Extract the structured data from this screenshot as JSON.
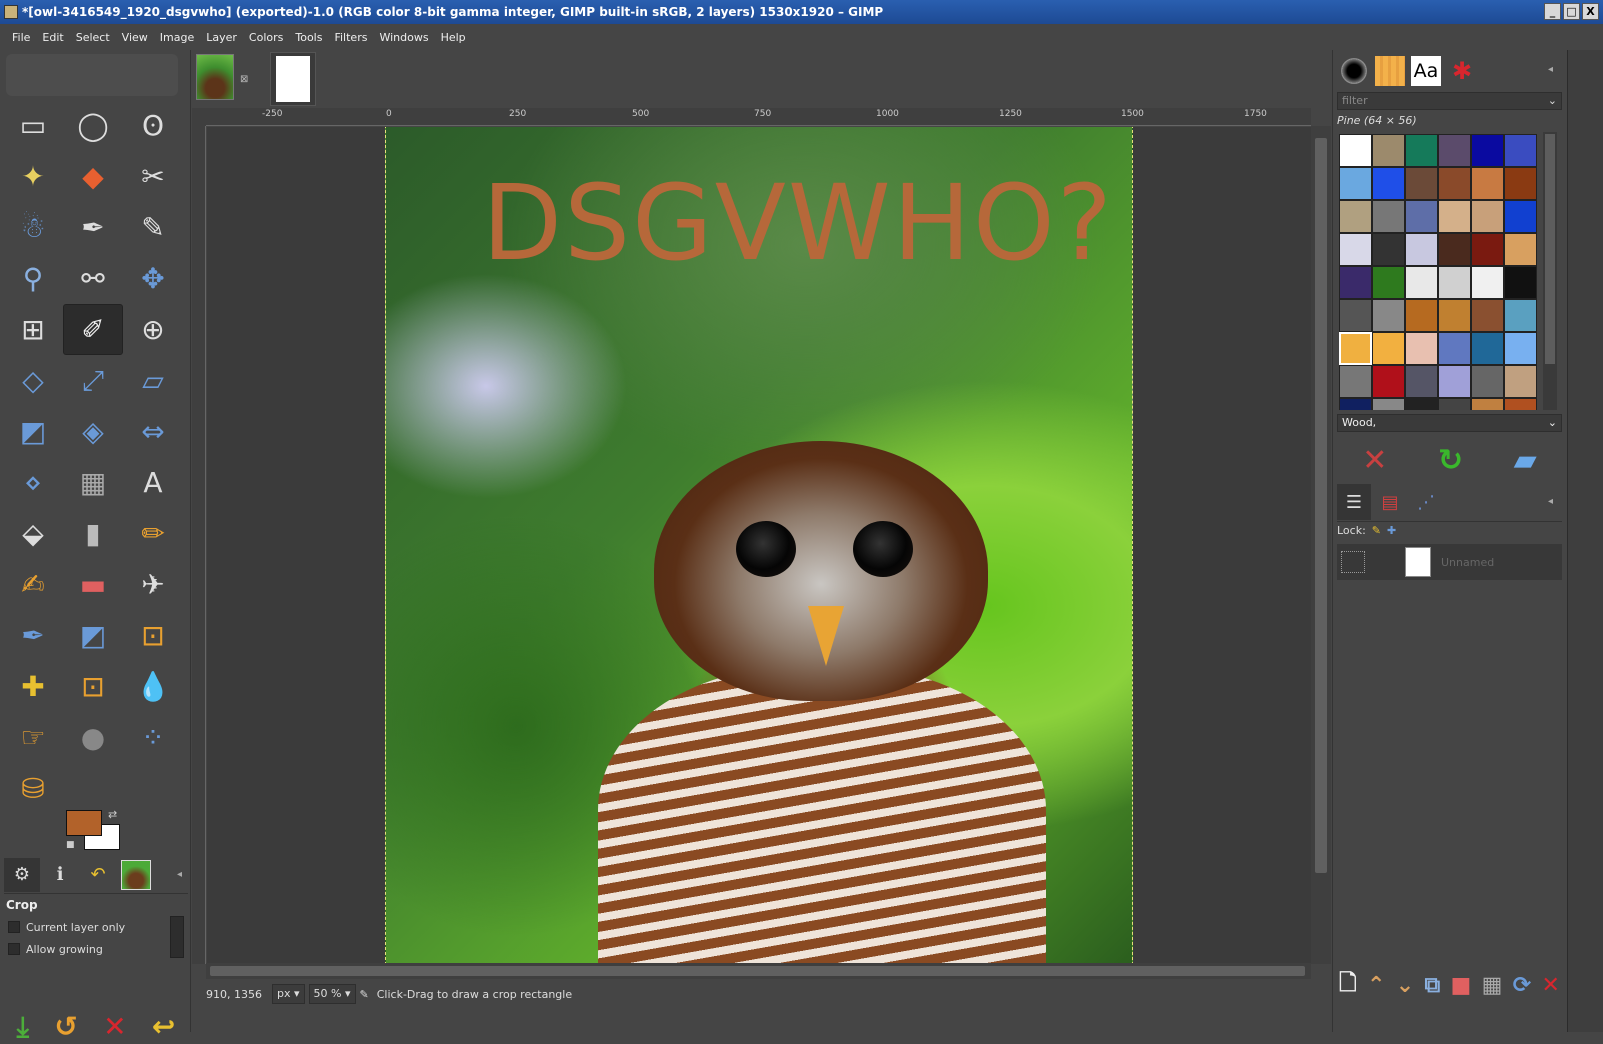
{
  "window": {
    "title": "*[owl-3416549_1920_dsgvwho] (exported)-1.0 (RGB color 8-bit gamma integer, GIMP built-in sRGB, 2 layers) 1530x1920 – GIMP",
    "buttons": [
      "_",
      "□",
      "X"
    ]
  },
  "menubar": [
    "File",
    "Edit",
    "Select",
    "View",
    "Image",
    "Layer",
    "Colors",
    "Tools",
    "Filters",
    "Windows",
    "Help"
  ],
  "toolbox": {
    "tools": [
      "rect-select-tool-icon",
      "ellipse-select-tool-icon",
      "free-select-tool-icon",
      "fuzzy-select-tool-icon",
      "select-by-color-tool-icon",
      "scissors-tool-icon",
      "foreground-select-tool-icon",
      "paths-tool-icon",
      "color-picker-tool-icon",
      "zoom-tool-icon",
      "measure-tool-icon",
      "move-tool-icon",
      "align-tool-icon",
      "crop-tool-icon",
      "unified-transform-tool-icon",
      "rotate-tool-icon",
      "scale-tool-icon",
      "shear-tool-icon",
      "perspective-tool-icon",
      "3d-transform-tool-icon",
      "flip-tool-icon",
      "cage-transform-tool-icon",
      "warp-transform-tool-icon",
      "text-tool-icon",
      "bucket-fill-tool-icon",
      "gradient-tool-icon",
      "pencil-tool-icon",
      "paintbrush-tool-icon",
      "eraser-tool-icon",
      "airbrush-tool-icon",
      "ink-tool-icon",
      "mypaint-brush-tool-icon",
      "clone-tool-icon",
      "heal-tool-icon",
      "perspective-clone-tool-icon",
      "blur-sharpen-tool-icon",
      "smudge-tool-icon",
      "dodge-burn-tool-icon",
      "n-point-deformation-tool-icon",
      "gegl-operation-tool-icon"
    ],
    "active_tool": "crop-tool-icon",
    "fg_color": "#b2622a",
    "bg_color": "#ffffff",
    "tabs": [
      "tool-options-icon",
      "device-status-icon",
      "undo-history-icon",
      "images-icon"
    ],
    "options": {
      "title": "Crop",
      "current_layer_only": "Current layer only",
      "allow_growing": "Allow growing"
    },
    "option_buttons": [
      "save-preset-icon",
      "restore-preset-icon",
      "delete-preset-icon",
      "reset-options-icon"
    ]
  },
  "ruler": {
    "labels": [
      "-250",
      "0",
      "250",
      "500",
      "750",
      "1000",
      "1250",
      "1500",
      "1750"
    ]
  },
  "canvas": {
    "overlay_text": "DSGVWHO?",
    "overlay_color": "#b6683a"
  },
  "status": {
    "coords": "910, 1356",
    "unit": "px",
    "zoom": "50 %",
    "hint": "Click-Drag to draw a crop rectangle"
  },
  "dock": {
    "tabs": [
      "brushes-icon",
      "patterns-icon",
      "fonts-icon",
      "gimp-wilber-icon"
    ],
    "filter_placeholder": "filter",
    "pattern_name": "Pine (64 × 56)",
    "tag": "Wood,",
    "pattern_colors": [
      "#ffffff",
      "#9c8a6c",
      "#157a5a",
      "#5b4b6b",
      "#0a0aa0",
      "#3a4cc0",
      "#6aa8e0",
      "#1f4fe8",
      "#6b4a38",
      "#8a4a2a",
      "#c87a42",
      "#8a3a12",
      "#b0a080",
      "#777",
      "#5e6ea8",
      "#d4b08a",
      "#c8a07a",
      "#1140d0",
      "#d8d8e8",
      "#333",
      "#c8c8e0",
      "#4a2a1e",
      "#7a1a10",
      "#d8a060",
      "#3a2a6a",
      "#2e7a1e",
      "#e8e8e8",
      "#d0d0d0",
      "#f0f0f0",
      "#111",
      "#555",
      "#888",
      "#b66a20",
      "#c08030",
      "#8a5030",
      "#5aa0c0",
      "#f0b040",
      "#f2b040",
      "#e8c0b0",
      "#6078c0",
      "#206898",
      "#78b0f0",
      "#777",
      "#b0101a",
      "#556",
      "#a0a0d8",
      "#666",
      "#c0a080",
      "#102060",
      "#888",
      "#222",
      "#444",
      "#c08040",
      "#b05020"
    ],
    "pattern_buttons": [
      "delete-pattern-icon",
      "refresh-patterns-icon",
      "open-pattern-as-image-icon"
    ],
    "layer_tabs": [
      "layers-icon",
      "channels-icon",
      "paths-icon"
    ],
    "lock_label": "Lock:",
    "layer_name": "Unnamed",
    "layer_buttons": [
      "new-layer-icon",
      "raise-layer-icon",
      "lower-layer-icon",
      "duplicate-layer-icon",
      "anchor-layer-icon",
      "mask-layer-icon",
      "merge-layer-icon",
      "delete-layer-icon"
    ]
  }
}
